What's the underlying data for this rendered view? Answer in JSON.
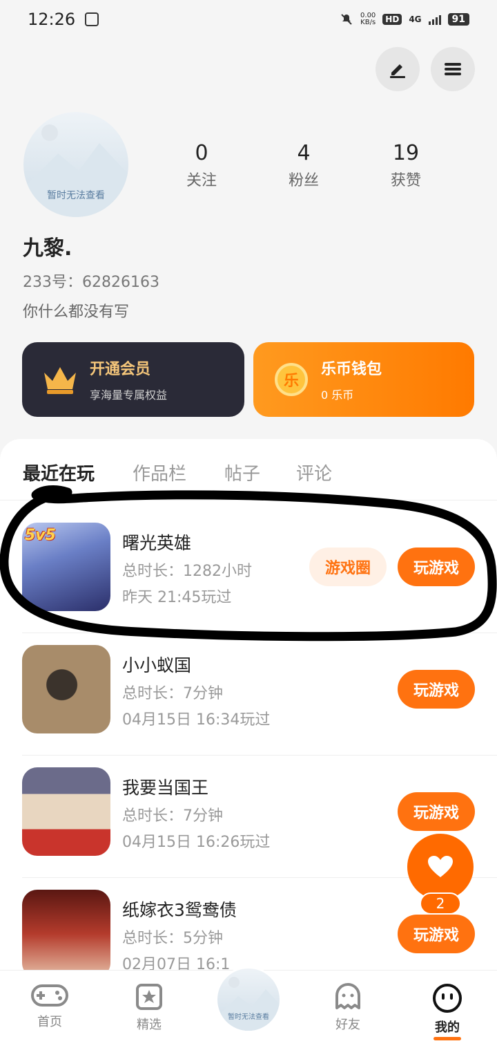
{
  "status_bar": {
    "time": "12:26",
    "net_speed": "0.00",
    "net_unit": "KB/s",
    "hd": "HD",
    "network": "4G",
    "battery": "91"
  },
  "profile": {
    "avatar_text": "暂时无法查看",
    "stats": [
      {
        "value": "0",
        "label": "关注"
      },
      {
        "value": "4",
        "label": "粉丝"
      },
      {
        "value": "19",
        "label": "获赞"
      }
    ],
    "nickname": "九黎.",
    "uid": "233号：62826163",
    "bio": "你什么都没有写"
  },
  "cards": {
    "vip": {
      "title": "开通会员",
      "subtitle": "享海量专属权益"
    },
    "wallet": {
      "icon_char": "乐",
      "title": "乐币钱包",
      "subtitle": "0 乐币"
    }
  },
  "tabs": [
    "最近在玩",
    "作品栏",
    "帖子",
    "评论"
  ],
  "games": [
    {
      "name": "曙光英雄",
      "duration": "总时长：1282小时",
      "last_played": "昨天 21:45玩过",
      "badge": "5v5",
      "circle_label": "游戏圈",
      "play_label": "玩游戏"
    },
    {
      "name": "小小蚁国",
      "duration": "总时长：7分钟",
      "last_played": "04月15日 16:34玩过",
      "play_label": "玩游戏"
    },
    {
      "name": "我要当国王",
      "duration": "总时长：7分钟",
      "last_played": "04月15日 16:26玩过",
      "play_label": "玩游戏"
    },
    {
      "name": "纸嫁衣3鸳鸯债",
      "duration": "总时长：5分钟",
      "last_played": "02月07日 16:1",
      "play_label": "玩游戏"
    }
  ],
  "fab": {
    "count": "2"
  },
  "nav": {
    "items": [
      "首页",
      "精选",
      "好友",
      "我的"
    ],
    "center_text": "暂时无法查看"
  },
  "colors": {
    "accent": "#ff7210",
    "vip_bg": "#2a2a37",
    "vip_gold": "#f5c67a"
  }
}
